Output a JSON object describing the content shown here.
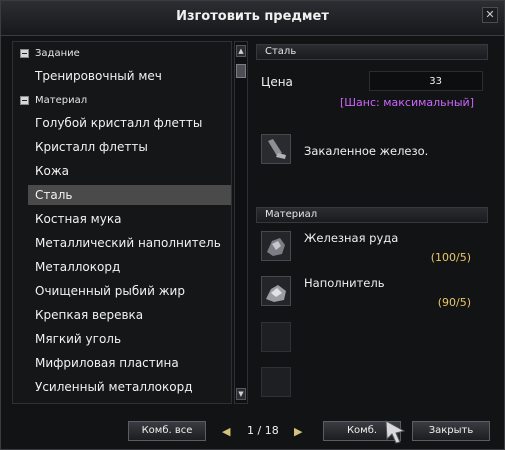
{
  "window": {
    "title": "Изготовить предмет",
    "close_symbol": "✕"
  },
  "recipe_list": {
    "header_task": "Задание",
    "task_item": "Тренировочный меч",
    "header_material": "Материал",
    "items": [
      "Голубой кристалл флетты",
      "Кристалл флетты",
      "Кожа",
      "Сталь",
      "Костная мука",
      "Металлический наполнитель",
      "Металлокорд",
      "Очищенный рыбий жир",
      "Крепкая веревка",
      "Мягкий уголь",
      "Мифриловая пластина",
      "Усиленный металлокорд"
    ],
    "selected_index": 3
  },
  "scrollbar": {
    "up_symbol": "▲",
    "down_symbol": "▼"
  },
  "details": {
    "item_header": "Сталь",
    "price_label": "Цена",
    "price_value": "33",
    "chance": "[Шанс: максимальный]",
    "result_name": "Закаленное железо.",
    "materials_header": "Материал",
    "materials": [
      {
        "name": "Железная руда",
        "count": "(100/5)",
        "icon": "iron-ore-icon"
      },
      {
        "name": "Наполнитель",
        "count": "(90/5)",
        "icon": "filler-icon"
      }
    ]
  },
  "footer": {
    "combine_all_label": "Комб. все",
    "prev_symbol": "◀",
    "next_symbol": "▶",
    "page": "1 / 18",
    "combine_label": "Комб.",
    "close_label": "Закрыть"
  },
  "colors": {
    "chance": "#cc66ff",
    "count": "#e8c66a",
    "selected": "#4a4a4a"
  }
}
